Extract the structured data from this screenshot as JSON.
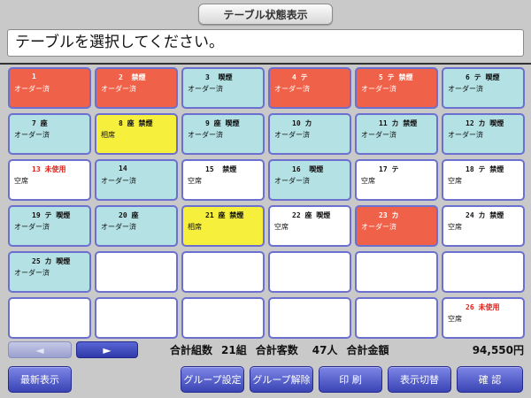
{
  "header": {
    "title": "テーブル状態表示",
    "message": "テーブルを選択してください。"
  },
  "tables": [
    {
      "head": "1",
      "status": "オーダー済",
      "color": "orange"
    },
    {
      "head": "2  禁煙",
      "status": "オーダー済",
      "color": "orange"
    },
    {
      "head": "3  喫煙",
      "status": "オーダー済",
      "color": "ordered"
    },
    {
      "head": "4 テ",
      "status": "オーダー済",
      "color": "orange"
    },
    {
      "head": "5 テ 禁煙",
      "status": "オーダー済",
      "color": "orange"
    },
    {
      "head": "6 テ 喫煙",
      "status": "オーダー済",
      "color": "ordered"
    },
    {
      "head": "7 座",
      "status": "オーダー済",
      "color": "ordered"
    },
    {
      "head": "8 座 禁煙",
      "status": "相席",
      "color": "yellow"
    },
    {
      "head": "9 座 喫煙",
      "status": "オーダー済",
      "color": "ordered"
    },
    {
      "head": "10 カ",
      "status": "オーダー済",
      "color": "ordered"
    },
    {
      "head": "11 カ 禁煙",
      "status": "オーダー済",
      "color": "ordered"
    },
    {
      "head": "12 カ 喫煙",
      "status": "オーダー済",
      "color": "ordered"
    },
    {
      "head": "13 未使用",
      "status": "空席",
      "color": "empty",
      "red": true
    },
    {
      "head": "14",
      "status": "オーダー済",
      "color": "ordered"
    },
    {
      "head": "15  禁煙",
      "status": "空席",
      "color": "empty"
    },
    {
      "head": "16  喫煙",
      "status": "オーダー済",
      "color": "ordered"
    },
    {
      "head": "17 テ",
      "status": "空席",
      "color": "empty"
    },
    {
      "head": "18 テ 禁煙",
      "status": "空席",
      "color": "empty"
    },
    {
      "head": "19 テ 喫煙",
      "status": "オーダー済",
      "color": "ordered"
    },
    {
      "head": "20 座",
      "status": "オーダー済",
      "color": "ordered"
    },
    {
      "head": "21 座 禁煙",
      "status": "相席",
      "color": "yellow"
    },
    {
      "head": "22 座 喫煙",
      "status": "空席",
      "color": "empty"
    },
    {
      "head": "23 カ",
      "status": "オーダー済",
      "color": "orange"
    },
    {
      "head": "24 カ 禁煙",
      "status": "空席",
      "color": "empty"
    },
    {
      "head": "25 カ 喫煙",
      "status": "オーダー済",
      "color": "ordered"
    },
    {
      "head": "",
      "status": "",
      "color": "empty"
    },
    {
      "head": "",
      "status": "",
      "color": "empty"
    },
    {
      "head": "",
      "status": "",
      "color": "empty"
    },
    {
      "head": "",
      "status": "",
      "color": "empty"
    },
    {
      "head": "",
      "status": "",
      "color": "empty"
    },
    {
      "head": "",
      "status": "",
      "color": "empty"
    },
    {
      "head": "",
      "status": "",
      "color": "empty"
    },
    {
      "head": "",
      "status": "",
      "color": "empty"
    },
    {
      "head": "",
      "status": "",
      "color": "empty"
    },
    {
      "head": "",
      "status": "",
      "color": "empty"
    },
    {
      "head": "26 未使用",
      "status": "空席",
      "color": "empty",
      "red": true
    }
  ],
  "nav": {
    "prev_icon": "arrow-left-icon",
    "next_icon": "arrow-right-icon",
    "prev_glyph": "◄",
    "next_glyph": "►"
  },
  "totals": {
    "groups_label": "合計組数",
    "groups_value": "21組",
    "guests_label": "合計客数",
    "guests_value": "47人",
    "amount_label": "合計金額",
    "amount_value": "94,550円"
  },
  "buttons": {
    "refresh": "最新表示",
    "group_set": "グループ設定",
    "group_release": "グループ解除",
    "print": "印 刷",
    "display_switch": "表示切替",
    "confirm": "確 認"
  },
  "colors": {
    "ordered": "#b4e1e4",
    "orange": "#ef6149",
    "yellow": "#f6ef3c",
    "border": "#6b6fcf",
    "button": "#3a44b4"
  }
}
